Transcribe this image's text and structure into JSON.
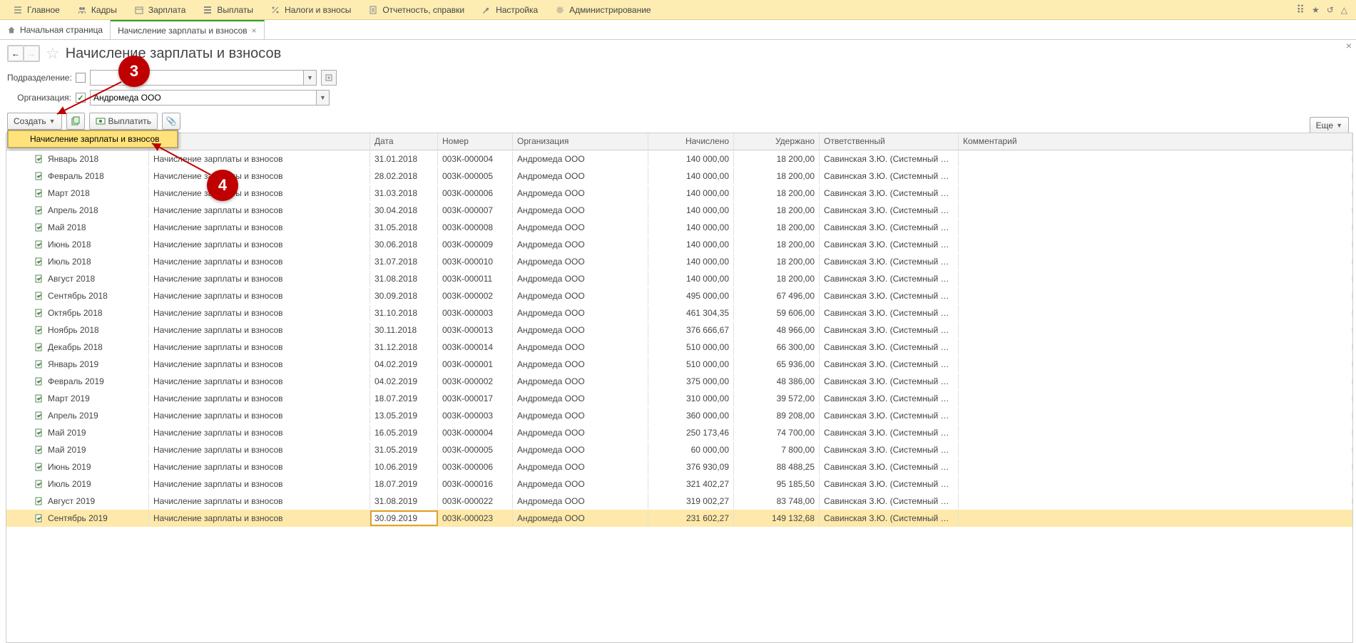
{
  "topmenu": {
    "items": [
      {
        "icon": "menu",
        "label": "Главное"
      },
      {
        "icon": "people",
        "label": "Кадры"
      },
      {
        "icon": "calendar",
        "label": "Зарплата"
      },
      {
        "icon": "list",
        "label": "Выплаты"
      },
      {
        "icon": "percent",
        "label": "Налоги и взносы"
      },
      {
        "icon": "report",
        "label": "Отчетность, справки"
      },
      {
        "icon": "wrench",
        "label": "Настройка"
      },
      {
        "icon": "gear",
        "label": "Администрирование"
      }
    ]
  },
  "tabs": {
    "home": "Начальная страница",
    "active": "Начисление зарплаты и взносов"
  },
  "page_title": "Начисление зарплаты и взносов",
  "filters": {
    "dept_label": "Подразделение:",
    "dept_value": "",
    "org_label": "Организация:",
    "org_value": "Андромеда ООО"
  },
  "actions": {
    "create": "Создать",
    "pay": "Выплатить",
    "more": "Еще",
    "menu_item": "Начисление зарплаты и взносов"
  },
  "columns": {
    "period": "",
    "doctype": "",
    "date": "Дата",
    "num": "Номер",
    "org": "Организация",
    "accrued": "Начислено",
    "withheld": "Удержано",
    "responsible": "Ответственный",
    "comment": "Комментарий"
  },
  "common": {
    "doctype": "Начисление зарплаты и взносов",
    "org": "Андромеда ООО",
    "resp": "Савинская З.Ю. (Системный прогр…"
  },
  "rows": [
    {
      "period": "Январь 2018",
      "date": "31.01.2018",
      "num": "003К-000004",
      "accr": "140 000,00",
      "with": "18 200,00"
    },
    {
      "period": "Февраль 2018",
      "date": "28.02.2018",
      "num": "003К-000005",
      "accr": "140 000,00",
      "with": "18 200,00"
    },
    {
      "period": "Март 2018",
      "date": "31.03.2018",
      "num": "003К-000006",
      "accr": "140 000,00",
      "with": "18 200,00"
    },
    {
      "period": "Апрель 2018",
      "date": "30.04.2018",
      "num": "003К-000007",
      "accr": "140 000,00",
      "with": "18 200,00"
    },
    {
      "period": "Май 2018",
      "date": "31.05.2018",
      "num": "003К-000008",
      "accr": "140 000,00",
      "with": "18 200,00"
    },
    {
      "period": "Июнь 2018",
      "date": "30.06.2018",
      "num": "003К-000009",
      "accr": "140 000,00",
      "with": "18 200,00"
    },
    {
      "period": "Июль 2018",
      "date": "31.07.2018",
      "num": "003К-000010",
      "accr": "140 000,00",
      "with": "18 200,00"
    },
    {
      "period": "Август 2018",
      "date": "31.08.2018",
      "num": "003К-000011",
      "accr": "140 000,00",
      "with": "18 200,00"
    },
    {
      "period": "Сентябрь 2018",
      "date": "30.09.2018",
      "num": "003К-000002",
      "accr": "495 000,00",
      "with": "67 496,00"
    },
    {
      "period": "Октябрь 2018",
      "date": "31.10.2018",
      "num": "003К-000003",
      "accr": "461 304,35",
      "with": "59 606,00"
    },
    {
      "period": "Ноябрь 2018",
      "date": "30.11.2018",
      "num": "003К-000013",
      "accr": "376 666,67",
      "with": "48 966,00"
    },
    {
      "period": "Декабрь 2018",
      "date": "31.12.2018",
      "num": "003К-000014",
      "accr": "510 000,00",
      "with": "66 300,00"
    },
    {
      "period": "Январь 2019",
      "date": "04.02.2019",
      "num": "003К-000001",
      "accr": "510 000,00",
      "with": "65 936,00"
    },
    {
      "period": "Февраль 2019",
      "date": "04.02.2019",
      "num": "003К-000002",
      "accr": "375 000,00",
      "with": "48 386,00"
    },
    {
      "period": "Март 2019",
      "date": "18.07.2019",
      "num": "003К-000017",
      "accr": "310 000,00",
      "with": "39 572,00"
    },
    {
      "period": "Апрель 2019",
      "date": "13.05.2019",
      "num": "003К-000003",
      "accr": "360 000,00",
      "with": "89 208,00"
    },
    {
      "period": "Май 2019",
      "date": "16.05.2019",
      "num": "003К-000004",
      "accr": "250 173,46",
      "with": "74 700,00"
    },
    {
      "period": "Май 2019",
      "date": "31.05.2019",
      "num": "003К-000005",
      "accr": "60 000,00",
      "with": "7 800,00"
    },
    {
      "period": "Июнь 2019",
      "date": "10.06.2019",
      "num": "003К-000006",
      "accr": "376 930,09",
      "with": "88 488,25"
    },
    {
      "period": "Июль 2019",
      "date": "18.07.2019",
      "num": "003К-000016",
      "accr": "321 402,27",
      "with": "95 185,50"
    },
    {
      "period": "Август 2019",
      "date": "31.08.2019",
      "num": "003К-000022",
      "accr": "319 002,27",
      "with": "83 748,00"
    },
    {
      "period": "Сентябрь 2019",
      "date": "30.09.2019",
      "num": "003К-000023",
      "accr": "231 602,27",
      "with": "149 132,68",
      "selected": true
    }
  ],
  "annotations": {
    "a3": "3",
    "a4": "4"
  }
}
